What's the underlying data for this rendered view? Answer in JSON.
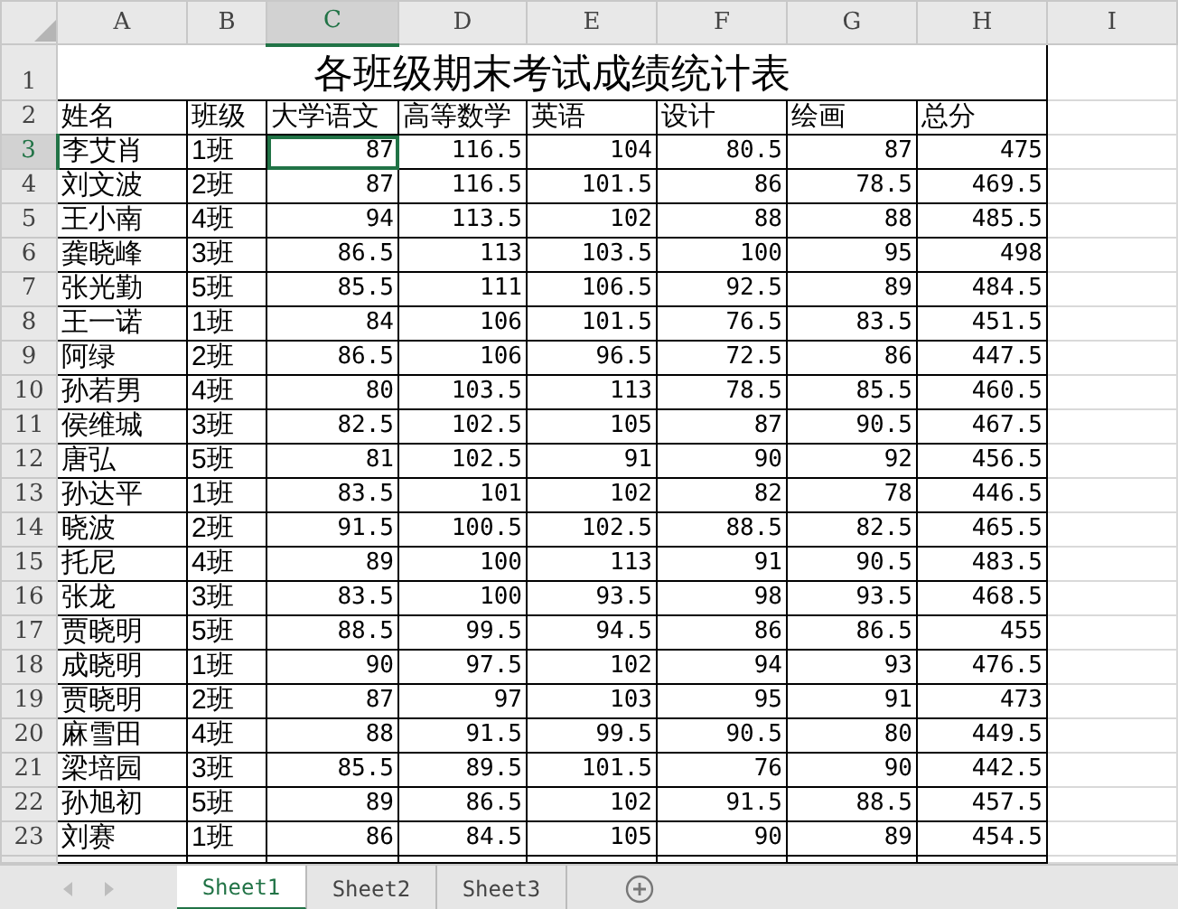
{
  "column_headers": [
    {
      "label": "A",
      "selected": false
    },
    {
      "label": "B",
      "selected": false
    },
    {
      "label": "C",
      "selected": true
    },
    {
      "label": "D",
      "selected": false
    },
    {
      "label": "E",
      "selected": false
    },
    {
      "label": "F",
      "selected": false
    },
    {
      "label": "G",
      "selected": false
    },
    {
      "label": "H",
      "selected": false
    },
    {
      "label": "I",
      "selected": false
    }
  ],
  "rows": [
    {
      "number": "1",
      "selected": false,
      "kind": "title",
      "title": "各班级期末考试成绩统计表"
    },
    {
      "number": "2",
      "selected": false,
      "kind": "header",
      "cells": [
        "姓名",
        "班级",
        "大学语文",
        "高等数学",
        "英语",
        "设计",
        "绘画",
        "总分"
      ]
    },
    {
      "number": "3",
      "selected": true,
      "kind": "data",
      "cells": [
        "李艾肖",
        "1班",
        "87",
        "116.5",
        "104",
        "80.5",
        "87",
        "475"
      ]
    },
    {
      "number": "4",
      "selected": false,
      "kind": "data",
      "cells": [
        "刘文波",
        "2班",
        "87",
        "116.5",
        "101.5",
        "86",
        "78.5",
        "469.5"
      ]
    },
    {
      "number": "5",
      "selected": false,
      "kind": "data",
      "cells": [
        "王小南",
        "4班",
        "94",
        "113.5",
        "102",
        "88",
        "88",
        "485.5"
      ]
    },
    {
      "number": "6",
      "selected": false,
      "kind": "data",
      "cells": [
        "龚晓峰",
        "3班",
        "86.5",
        "113",
        "103.5",
        "100",
        "95",
        "498"
      ]
    },
    {
      "number": "7",
      "selected": false,
      "kind": "data",
      "cells": [
        "张光勤",
        "5班",
        "85.5",
        "111",
        "106.5",
        "92.5",
        "89",
        "484.5"
      ]
    },
    {
      "number": "8",
      "selected": false,
      "kind": "data",
      "cells": [
        "王一诺",
        "1班",
        "84",
        "106",
        "101.5",
        "76.5",
        "83.5",
        "451.5"
      ]
    },
    {
      "number": "9",
      "selected": false,
      "kind": "data",
      "cells": [
        "阿绿",
        "2班",
        "86.5",
        "106",
        "96.5",
        "72.5",
        "86",
        "447.5"
      ]
    },
    {
      "number": "10",
      "selected": false,
      "kind": "data",
      "cells": [
        "孙若男",
        "4班",
        "80",
        "103.5",
        "113",
        "78.5",
        "85.5",
        "460.5"
      ]
    },
    {
      "number": "11",
      "selected": false,
      "kind": "data",
      "cells": [
        "侯维城",
        "3班",
        "82.5",
        "102.5",
        "105",
        "87",
        "90.5",
        "467.5"
      ]
    },
    {
      "number": "12",
      "selected": false,
      "kind": "data",
      "cells": [
        "唐弘",
        "5班",
        "81",
        "102.5",
        "91",
        "90",
        "92",
        "456.5"
      ]
    },
    {
      "number": "13",
      "selected": false,
      "kind": "data",
      "cells": [
        "孙达平",
        "1班",
        "83.5",
        "101",
        "102",
        "82",
        "78",
        "446.5"
      ]
    },
    {
      "number": "14",
      "selected": false,
      "kind": "data",
      "cells": [
        "晓波",
        "2班",
        "91.5",
        "100.5",
        "102.5",
        "88.5",
        "82.5",
        "465.5"
      ]
    },
    {
      "number": "15",
      "selected": false,
      "kind": "data",
      "cells": [
        "托尼",
        "4班",
        "89",
        "100",
        "113",
        "91",
        "90.5",
        "483.5"
      ]
    },
    {
      "number": "16",
      "selected": false,
      "kind": "data",
      "cells": [
        "张龙",
        "3班",
        "83.5",
        "100",
        "93.5",
        "98",
        "93.5",
        "468.5"
      ]
    },
    {
      "number": "17",
      "selected": false,
      "kind": "data",
      "cells": [
        "贾晓明",
        "5班",
        "88.5",
        "99.5",
        "94.5",
        "86",
        "86.5",
        "455"
      ]
    },
    {
      "number": "18",
      "selected": false,
      "kind": "data",
      "cells": [
        "成晓明",
        "1班",
        "90",
        "97.5",
        "102",
        "94",
        "93",
        "476.5"
      ]
    },
    {
      "number": "19",
      "selected": false,
      "kind": "data",
      "cells": [
        "贾晓明",
        "2班",
        "87",
        "97",
        "103",
        "95",
        "91",
        "473"
      ]
    },
    {
      "number": "20",
      "selected": false,
      "kind": "data",
      "cells": [
        "麻雪田",
        "4班",
        "88",
        "91.5",
        "99.5",
        "90.5",
        "80",
        "449.5"
      ]
    },
    {
      "number": "21",
      "selected": false,
      "kind": "data",
      "cells": [
        "梁培园",
        "3班",
        "85.5",
        "89.5",
        "101.5",
        "76",
        "90",
        "442.5"
      ]
    },
    {
      "number": "22",
      "selected": false,
      "kind": "data",
      "cells": [
        "孙旭初",
        "5班",
        "89",
        "86.5",
        "102",
        "91.5",
        "88.5",
        "457.5"
      ]
    },
    {
      "number": "23",
      "selected": false,
      "kind": "data",
      "cells": [
        "刘赛",
        "1班",
        "86",
        "84.5",
        "105",
        "90",
        "89",
        "454.5"
      ]
    }
  ],
  "sheet_tabs": [
    {
      "label": "Sheet1",
      "selected": true
    },
    {
      "label": "Sheet2",
      "selected": false
    },
    {
      "label": "Sheet3",
      "selected": false
    }
  ]
}
